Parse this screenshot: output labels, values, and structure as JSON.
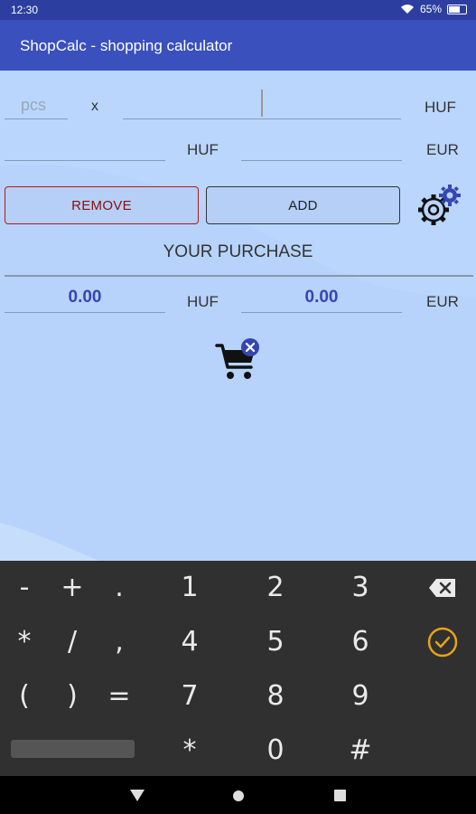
{
  "status_bar": {
    "time": "12:30",
    "battery": "65%"
  },
  "app_bar": {
    "title": "ShopCalc - shopping calculator"
  },
  "form": {
    "quantity_placeholder": "pcs",
    "times_symbol": "x",
    "price_currency": "HUF",
    "converted_huf_label": "HUF",
    "converted_eur_label": "EUR"
  },
  "buttons": {
    "remove": "REMOVE",
    "add": "ADD"
  },
  "purchase": {
    "title": "YOUR PURCHASE",
    "total_huf": "0.00",
    "total_huf_label": "HUF",
    "total_eur": "0.00",
    "total_eur_label": "EUR"
  },
  "keyboard": {
    "row1": [
      "-",
      "+",
      ".",
      "1",
      "2",
      "3"
    ],
    "row2": [
      "*",
      "/",
      ",",
      "4",
      "5",
      "6"
    ],
    "row3": [
      "(",
      ")",
      "=",
      "7",
      "8",
      "9"
    ],
    "row4": [
      "*",
      "0",
      "#"
    ]
  },
  "icons": {
    "settings": "gear-icon",
    "cart_clear": "cart-clear-icon",
    "backspace": "backspace-icon",
    "done": "check-circle-icon"
  },
  "colors": {
    "app_bar": "#3a50bd",
    "content_bg": "#b7d3fb",
    "value_text": "#3446b0",
    "remove_border": "#b21a1a",
    "done_accent": "#e8a317"
  }
}
